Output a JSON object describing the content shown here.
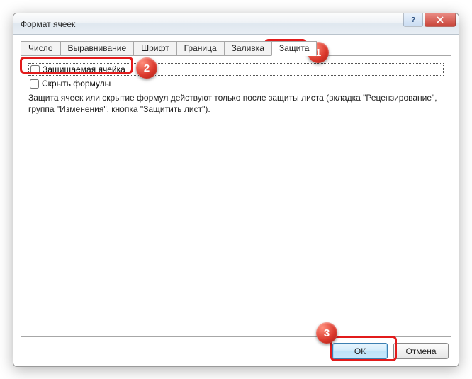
{
  "window": {
    "title": "Формат ячеек",
    "help_label": "?",
    "close_label": "×"
  },
  "tabs": [
    {
      "label": "Число"
    },
    {
      "label": "Выравнивание"
    },
    {
      "label": "Шрифт"
    },
    {
      "label": "Граница"
    },
    {
      "label": "Заливка"
    },
    {
      "label": "Защита"
    }
  ],
  "protection": {
    "locked_label": "Защищаемая ячейка",
    "hidden_label": "Скрыть формулы",
    "hint": "Защита ячеек или скрытие формул действуют только после защиты листа (вкладка \"Рецензирование\", группа \"Изменения\", кнопка \"Защитить лист\")."
  },
  "buttons": {
    "ok": "ОК",
    "cancel": "Отмена"
  },
  "annotations": {
    "badge1": "1",
    "badge2": "2",
    "badge3": "3"
  }
}
